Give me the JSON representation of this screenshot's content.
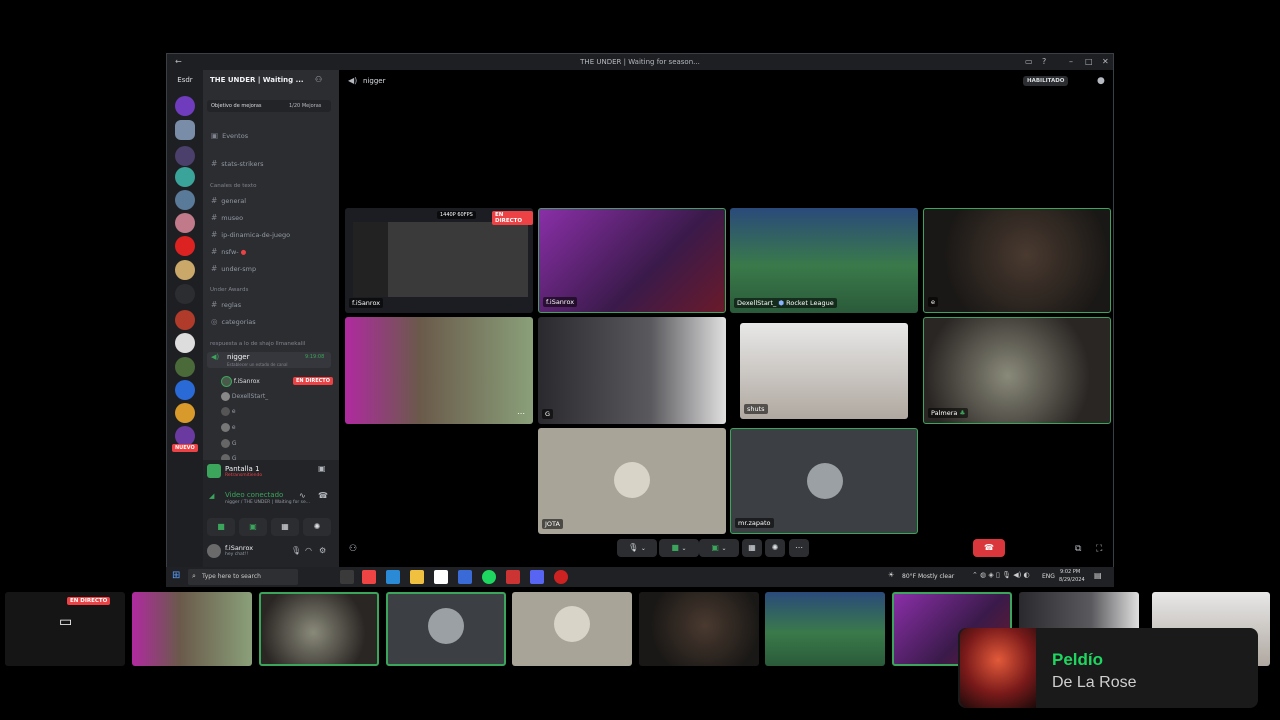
{
  "window": {
    "title": "THE UNDER | Waiting for season...",
    "back_icon": "arrow-left-icon",
    "controls": [
      "inbox-icon",
      "help-icon",
      "minimize-icon",
      "maximize-icon",
      "close-icon"
    ]
  },
  "server_list": {
    "label": "Esdr",
    "new_badge": "NUEVO"
  },
  "channel_sidebar": {
    "server_name": "THE UNDER | Waiting ...",
    "boost_goal": "Objetivo de mejoras",
    "boost_count": "1/20 Mejoras",
    "events": "Eventos",
    "categories": [
      {
        "label": "Canales de texto"
      },
      {
        "label": "Under Awards"
      },
      {
        "label": "respuesta a lo de shajo llmanekalil"
      }
    ],
    "channels": [
      {
        "name": "stats-strikers"
      },
      {
        "name": "general"
      },
      {
        "name": "museo"
      },
      {
        "name": "ip-dinamica-de-juego"
      },
      {
        "name": "nsfw-"
      },
      {
        "name": "under-smp"
      },
      {
        "name": "reglas"
      },
      {
        "name": "categorias"
      }
    ],
    "voice_channel": {
      "name": "nigger",
      "timer": "9:19:08",
      "status_hint": "Establecer un estado de canal"
    },
    "voice_users": [
      {
        "name": "f.iSanrox",
        "live": "EN DIRECTO"
      },
      {
        "name": "DexellStart_"
      },
      {
        "name": "e"
      },
      {
        "name": "e"
      },
      {
        "name": "G"
      },
      {
        "name": "G"
      }
    ],
    "screen_share": {
      "title": "Pantalla 1",
      "subtitle": "Retransmitiendo"
    },
    "video_connected": {
      "title": "Video conectado",
      "subtitle": "nigger / THE UNDER | Waiting for se..."
    },
    "user": {
      "name": "f.iSanrox",
      "status": "hey chat!!"
    }
  },
  "header": {
    "channel": "nigger",
    "enabled_label": "HABILITADO"
  },
  "tiles": [
    {
      "name": "f.iSanrox",
      "badge_quality": "1440P 60FPS",
      "badge_live": "EN DIRECTO"
    },
    {
      "name": "f.iSanrox"
    },
    {
      "name": "DexellStart_",
      "game": "Rocket League"
    },
    {
      "name": "e"
    },
    {
      "name": ""
    },
    {
      "name": "G"
    },
    {
      "name": "shuts"
    },
    {
      "name": "Palmera"
    },
    {
      "name": "JOTA"
    },
    {
      "name": "mr.zapato"
    }
  ],
  "taskbar": {
    "search": "Type here to search",
    "weather": "80°F  Mostly clear",
    "lang": "ENG",
    "time": "9:02 PM",
    "date": "8/29/2024"
  },
  "strip": {
    "live": "EN DIRECTO"
  },
  "music": {
    "title": "Peldío",
    "artist": "De La Rose"
  },
  "colors": {
    "accent_green": "#3ba55c",
    "live_red": "#ed4245",
    "disconnect_red": "#da373c",
    "music_title": "#1ed760"
  }
}
